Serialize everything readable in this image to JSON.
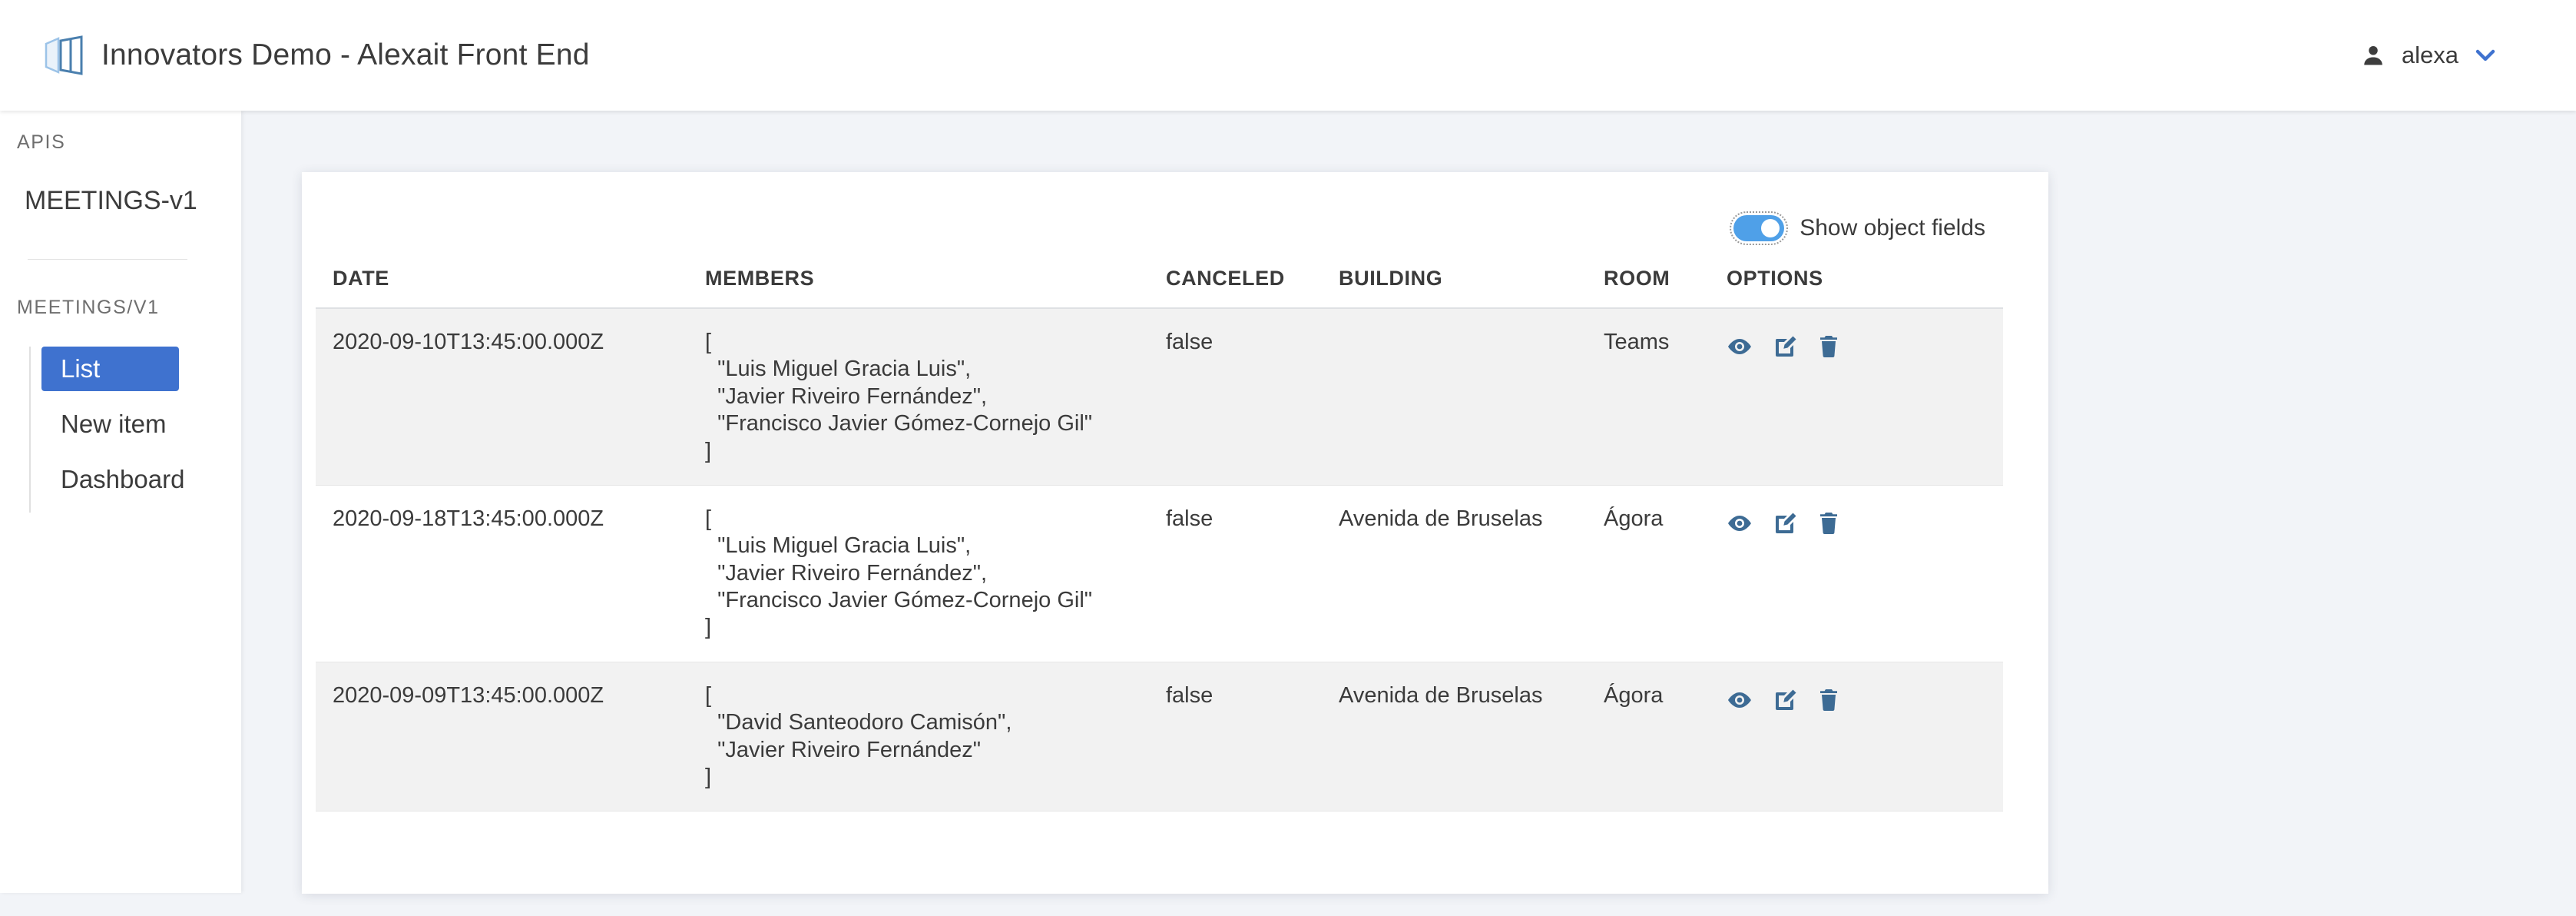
{
  "header": {
    "logo_icon": "panels-logo-icon",
    "title": "Innovators Demo - Alexait Front End",
    "user": {
      "icon": "person-icon",
      "name": "alexa",
      "chevron_icon": "chevron-down-icon"
    }
  },
  "sidebar": {
    "apis_label": "APIS",
    "apis": [
      {
        "label": "MEETINGS-v1"
      }
    ],
    "group_label": "MEETINGS/V1",
    "items": [
      {
        "label": "List",
        "active": true
      },
      {
        "label": "New item",
        "active": false
      },
      {
        "label": "Dashboard",
        "active": false
      }
    ]
  },
  "toolbar": {
    "show_object_fields_label": "Show object fields",
    "show_object_fields_on": true
  },
  "table": {
    "columns": [
      "DATE",
      "MEMBERS",
      "CANCELED",
      "BUILDING",
      "ROOM",
      "OPTIONS"
    ],
    "rows": [
      {
        "date": "2020-09-10T13:45:00.000Z",
        "members": "[\n  \"Luis Miguel Gracia Luis\",\n  \"Javier Riveiro Fernández\",\n  \"Francisco Javier Gómez-Cornejo Gil\"\n]",
        "canceled": "false",
        "building": "",
        "room": "Teams"
      },
      {
        "date": "2020-09-18T13:45:00.000Z",
        "members": "[\n  \"Luis Miguel Gracia Luis\",\n  \"Javier Riveiro Fernández\",\n  \"Francisco Javier Gómez-Cornejo Gil\"\n]",
        "canceled": "false",
        "building": "Avenida de Bruselas",
        "room": "Ágora"
      },
      {
        "date": "2020-09-09T13:45:00.000Z",
        "members": "[\n  \"David Santeodoro Camisón\",\n  \"Javier Riveiro Fernández\"\n]",
        "canceled": "false",
        "building": "Avenida de Bruselas",
        "room": "Ágora"
      }
    ],
    "row_actions": [
      {
        "icon": "eye-icon"
      },
      {
        "icon": "edit-pencil-icon"
      },
      {
        "icon": "trash-icon"
      }
    ]
  },
  "colors": {
    "accent": "#3f72cf",
    "toggle_on": "#4fa0e8",
    "action_icon": "#3d6b94",
    "page_bg": "#f2f4f8",
    "row_stripe": "#f2f2f2"
  }
}
